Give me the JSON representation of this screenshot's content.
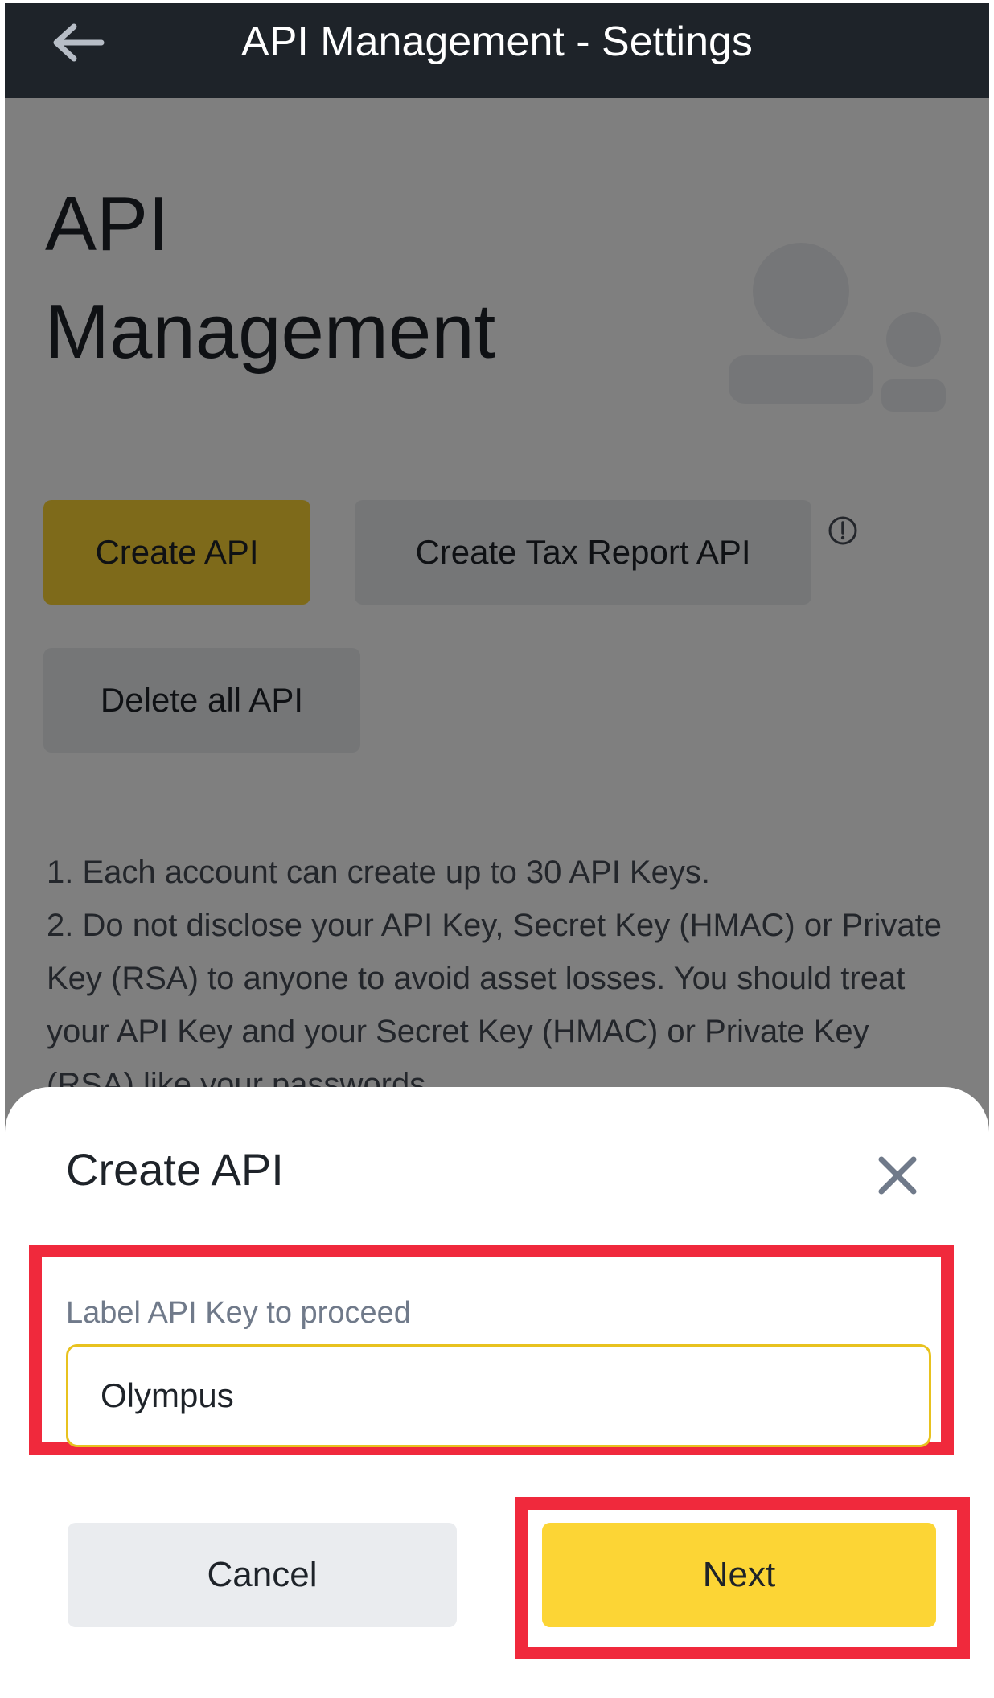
{
  "header": {
    "title": "API Management - Settings",
    "back_icon": "arrow-left-icon"
  },
  "page": {
    "title_line1": "API",
    "title_line2": "Management",
    "create_api_label": "Create API",
    "create_tax_label": "Create Tax Report API",
    "info_icon": "info-icon",
    "delete_all_label": "Delete all API",
    "notes": [
      "1. Each account can create up to 30 API Keys.",
      "2. Do not disclose your API Key, Secret Key (HMAC) or Private Key (RSA) to anyone to avoid asset losses. You should treat your API Key and your Secret Key (HMAC) or Private Key (RSA) like your passwords."
    ]
  },
  "dialog": {
    "title": "Create API",
    "close_icon": "close-icon",
    "field_label": "Label API Key to proceed",
    "field_value": "Olympus",
    "cancel_label": "Cancel",
    "next_label": "Next"
  },
  "colors": {
    "accent": "#fcd535",
    "highlight": "#f0293c",
    "topbar": "#1e2329"
  }
}
